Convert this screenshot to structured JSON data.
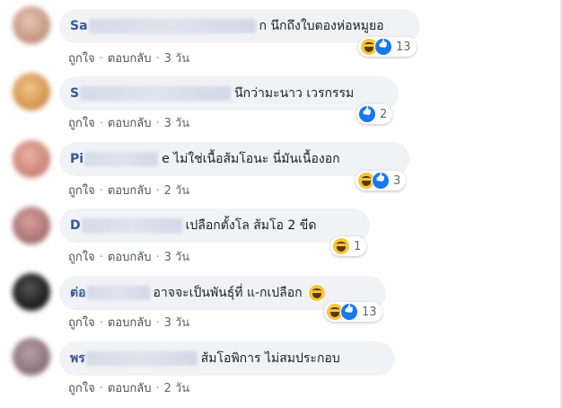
{
  "actions": {
    "like": "ถูกใจ",
    "reply": "ตอบกลับ",
    "separator": "·"
  },
  "colors": {
    "author": "#365899",
    "bubble": "#f0f2f5",
    "haha": "#f7c53b",
    "like": "#1877f2"
  },
  "comments": [
    {
      "author": "Sa",
      "text": "ก นึกถึงใบตองห่อหมูยอ",
      "time": "3 วัน",
      "reactions": [
        "haha-icon",
        "like-icon"
      ],
      "count": "13"
    },
    {
      "author": "S",
      "text": "นึกว่ามะนาว เวรกรรม",
      "time": "3 วัน",
      "reactions": [
        "like-icon"
      ],
      "count": "2"
    },
    {
      "author": "Pi",
      "text": "e ไม่ใช่เนื้อส้มโอนะ นี่มันเนื้องอก",
      "time": "2 วัน",
      "reactions": [
        "haha-icon",
        "like-icon"
      ],
      "count": "3"
    },
    {
      "author": "D",
      "text": "เปลือกตั้งโล ส้มโอ 2 ขีด",
      "time": "3 วัน",
      "reactions": [
        "haha-icon"
      ],
      "count": "1"
    },
    {
      "author": "ต่อ",
      "text": "อาจจะเป็นพันธุ์ที่ แ-กเปลือก",
      "time": "3 วัน",
      "reactions": [
        "haha-icon",
        "like-icon"
      ],
      "count": "13",
      "inline_emoji": "haha-icon"
    },
    {
      "author": "พร",
      "text": "ส้มโอพิการ ไม่สมประกอบ",
      "time": "2 วัน",
      "reactions": [],
      "count": ""
    }
  ]
}
